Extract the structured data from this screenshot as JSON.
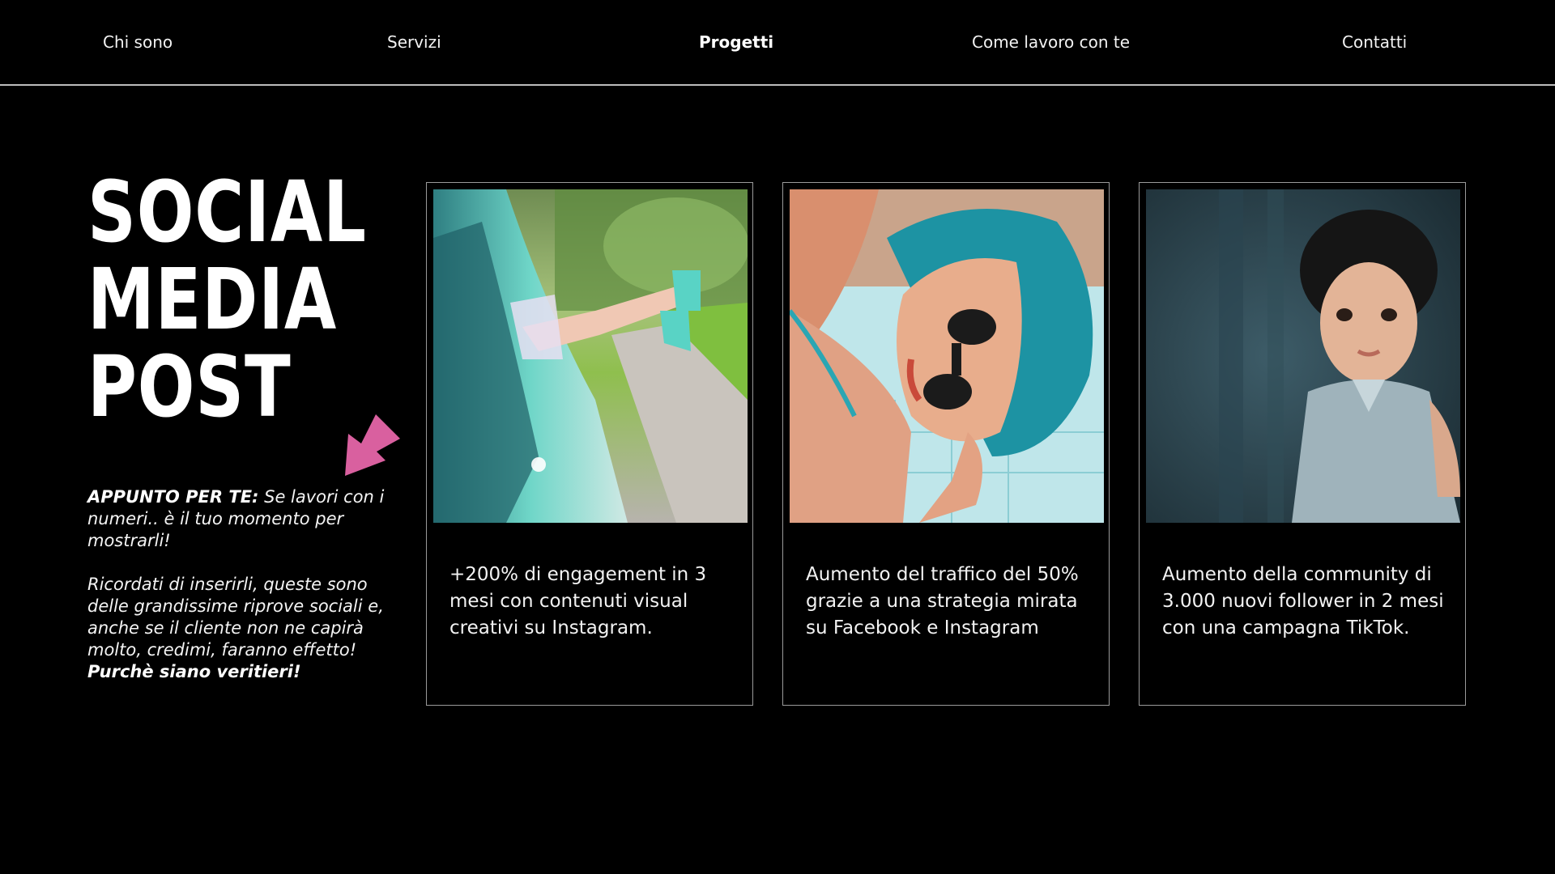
{
  "nav": {
    "items": [
      {
        "label": "Chi sono",
        "active": false
      },
      {
        "label": "Servizi",
        "active": false
      },
      {
        "label": "Progetti",
        "active": true
      },
      {
        "label": "Come lavoro con te",
        "active": false
      },
      {
        "label": "Contatti",
        "active": false
      }
    ]
  },
  "hero": {
    "line1": "SOCIAL",
    "line2": "MEDIA",
    "line3": "POST"
  },
  "arrow": {
    "icon": "arrow-down-left-icon",
    "color": "#d9609f"
  },
  "note": {
    "label": "APPUNTO PER TE:",
    "text1": " Se lavori con i numeri.. è il tuo momento per mostrarli!",
    "text2": "Ricordati di inserirli, queste sono delle grandissime riprove sociali e, anche se il cliente non ne capirà molto, credimi, faranno effetto! ",
    "emphasis": "Purchè siano veritieri!"
  },
  "cards": [
    {
      "text": "+200% di engagement in 3 mesi con contenuti visual creativi su Instagram."
    },
    {
      "text": "Aumento del traffico del 50% grazie a una strategia mirata su Facebook e Instagram"
    },
    {
      "text": "Aumento della community di 3.000 nuovi follower in 2 mesi con una campagna TikTok."
    }
  ],
  "colors": {
    "background": "#000000",
    "text": "#ffffff",
    "accent": "#d9609f",
    "border": "#9a9a9a"
  }
}
